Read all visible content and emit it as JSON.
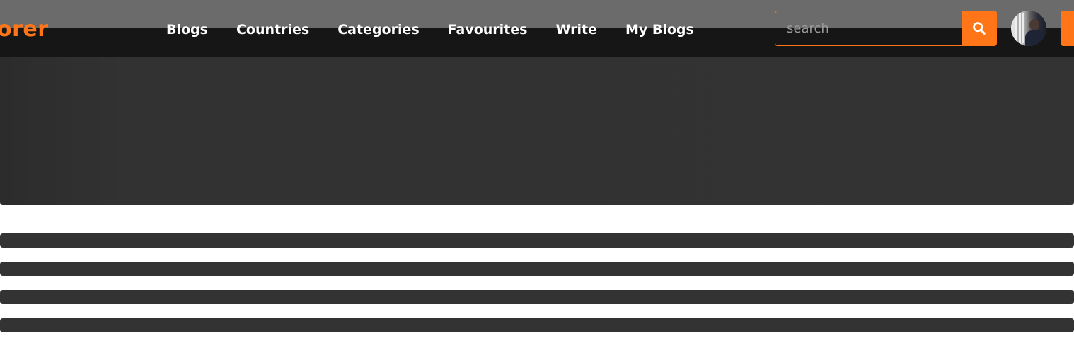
{
  "header": {
    "brand_text": "orer",
    "brand_color": "#ff7518",
    "background": "#161616",
    "nav": [
      {
        "label": "Blogs"
      },
      {
        "label": "Countries"
      },
      {
        "label": "Categories"
      },
      {
        "label": "Favourites"
      },
      {
        "label": "Write"
      },
      {
        "label": "My Blogs"
      }
    ],
    "search": {
      "placeholder": "search",
      "value": "",
      "button_icon": "search-icon"
    },
    "avatar": {
      "icon": "user-avatar"
    }
  },
  "content": {
    "hero_placeholder_color": "#333333",
    "skeleton_line_count": 4
  }
}
